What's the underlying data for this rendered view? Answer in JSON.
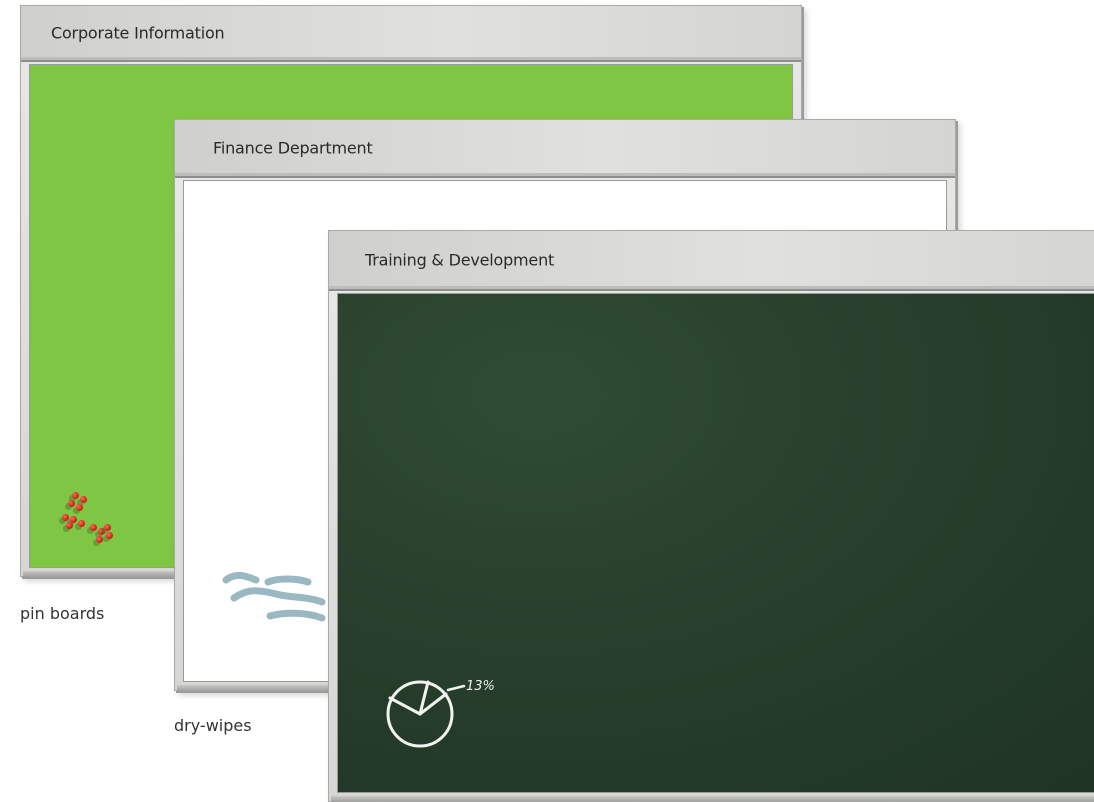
{
  "boards": [
    {
      "title": "Corporate Information",
      "surface": "pin board",
      "color": "#7fc644"
    },
    {
      "title": "Finance Department",
      "surface": "dry-wipe",
      "color": "#ffffff"
    },
    {
      "title": "Training & Development",
      "surface": "chalkboard",
      "color": "#273f2c"
    }
  ],
  "captions": {
    "pin_boards": "pin boards",
    "dry_wipes": "dry-wipes"
  },
  "doodles": {
    "pie_label": "13%"
  },
  "colors": {
    "frame": "#d6d7d4",
    "pin": "#c41a12",
    "marker": "#9ab8c2",
    "chalk": "#f2f2ee"
  }
}
